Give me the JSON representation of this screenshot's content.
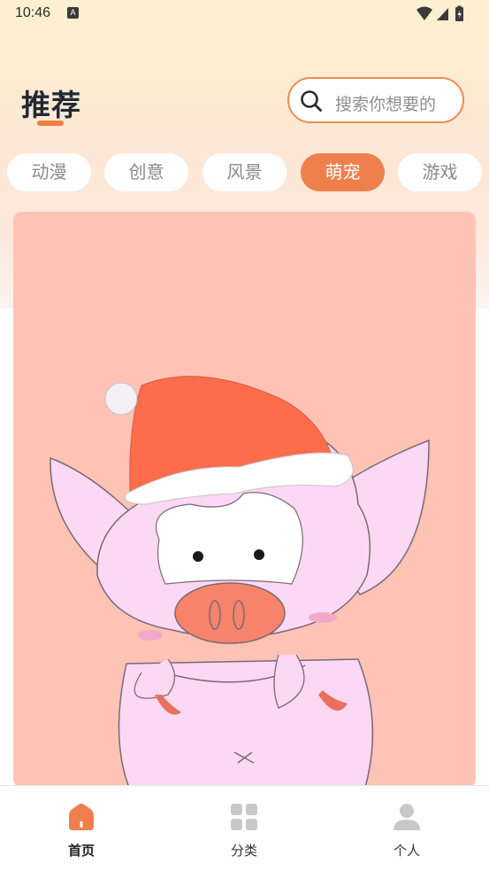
{
  "status_bar": {
    "time": "10:46",
    "notification_badge": "A",
    "icons": [
      "wifi-icon",
      "signal-icon",
      "battery-icon"
    ]
  },
  "header": {
    "title": "推荐"
  },
  "search": {
    "placeholder": "搜索你想要的"
  },
  "tabs": [
    {
      "label": "动漫",
      "active": false
    },
    {
      "label": "创意",
      "active": false
    },
    {
      "label": "风景",
      "active": false
    },
    {
      "label": "萌宠",
      "active": true
    },
    {
      "label": "游戏",
      "active": false
    }
  ],
  "wallpaper": {
    "subject": "pink-pig-with-santa-hat"
  },
  "bottom_nav": [
    {
      "label": "首页",
      "icon": "home-icon",
      "active": true
    },
    {
      "label": "分类",
      "icon": "grid-icon",
      "active": false
    },
    {
      "label": "个人",
      "icon": "user-icon",
      "active": false
    }
  ],
  "colors": {
    "accent": "#ef7f4d",
    "card_background": "#fec3b5",
    "inactive_icon": "#c8c8c8"
  }
}
